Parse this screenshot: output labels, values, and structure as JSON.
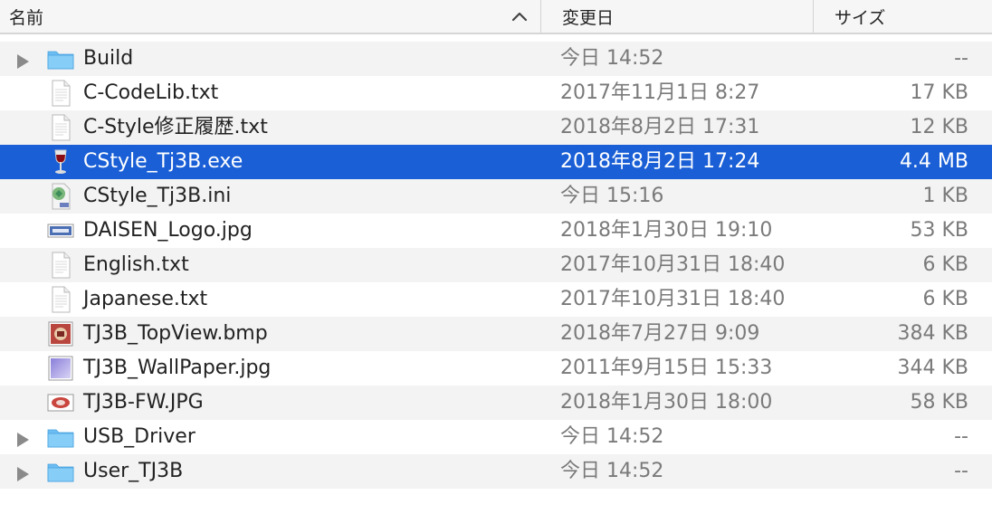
{
  "columns": {
    "name": "名前",
    "date": "変更日",
    "size": "サイズ"
  },
  "sort": {
    "column": "name",
    "direction": "ascending"
  },
  "colors": {
    "selection": "#1a5fd6",
    "folder": "#6cbdf2",
    "stripe": "#f3f3f3",
    "secondary_text": "#7a7a7a"
  },
  "files": [
    {
      "name": "Build",
      "date": "今日 14:52",
      "size": "--",
      "kind": "folder",
      "icon": "folder-icon"
    },
    {
      "name": "C-CodeLib.txt",
      "date": "2017年11月1日 8:27",
      "size": "17 KB",
      "kind": "text",
      "icon": "text-file-icon"
    },
    {
      "name": "C-Style修正履歴.txt",
      "date": "2018年8月2日 17:31",
      "size": "12 KB",
      "kind": "text",
      "icon": "text-file-icon"
    },
    {
      "name": "CStyle_Tj3B.exe",
      "date": "2018年8月2日 17:24",
      "size": "4.4 MB",
      "kind": "exe",
      "icon": "wine-glass-icon",
      "selected": true
    },
    {
      "name": "CStyle_Tj3B.ini",
      "date": "今日 15:16",
      "size": "1 KB",
      "kind": "ini",
      "icon": "settings-file-icon"
    },
    {
      "name": "DAISEN_Logo.jpg",
      "date": "2018年1月30日 19:10",
      "size": "53 KB",
      "kind": "image",
      "icon": "logo-image-icon"
    },
    {
      "name": "English.txt",
      "date": "2017年10月31日 18:40",
      "size": "6 KB",
      "kind": "text",
      "icon": "text-file-icon"
    },
    {
      "name": "Japanese.txt",
      "date": "2017年10月31日 18:40",
      "size": "6 KB",
      "kind": "text",
      "icon": "text-file-icon"
    },
    {
      "name": "TJ3B_TopView.bmp",
      "date": "2018年7月27日 9:09",
      "size": "384 KB",
      "kind": "image",
      "icon": "robot-image-icon"
    },
    {
      "name": "TJ3B_WallPaper.jpg",
      "date": "2011年9月15日 15:33",
      "size": "344 KB",
      "kind": "image",
      "icon": "wallpaper-image-icon"
    },
    {
      "name": "TJ3B-FW.JPG",
      "date": "2018年1月30日 18:00",
      "size": "58 KB",
      "kind": "image",
      "icon": "photo-image-icon"
    },
    {
      "name": "USB_Driver",
      "date": "今日 14:52",
      "size": "--",
      "kind": "folder",
      "icon": "folder-icon"
    },
    {
      "name": "User_TJ3B",
      "date": "今日 14:52",
      "size": "--",
      "kind": "folder",
      "icon": "folder-icon"
    }
  ]
}
